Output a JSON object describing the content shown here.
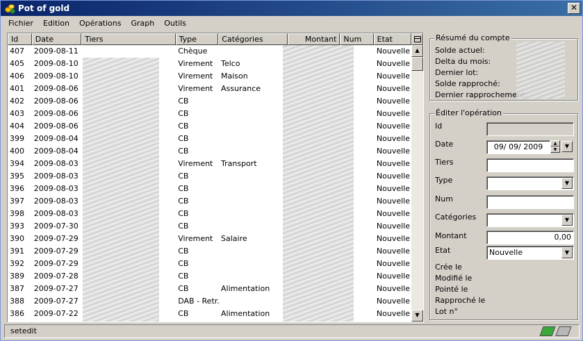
{
  "window": {
    "title": "Pot of gold",
    "close_label": "✕"
  },
  "menu": [
    "Fichier",
    "Edition",
    "Opérations",
    "Graph",
    "Outils"
  ],
  "table": {
    "columns": [
      "Id",
      "Date",
      "Tiers",
      "Type",
      "Catégories",
      "Montant",
      "Num",
      "Etat"
    ],
    "rows": [
      [
        "407",
        "2009-08-11",
        "",
        "Chèque",
        "",
        "",
        "",
        "Nouvelle"
      ],
      [
        "405",
        "2009-08-10",
        "",
        "Virement",
        "Telco",
        "",
        "",
        "Nouvelle"
      ],
      [
        "406",
        "2009-08-10",
        "",
        "Virement",
        "Maison",
        "",
        "",
        "Nouvelle"
      ],
      [
        "401",
        "2009-08-06",
        "",
        "Virement",
        "Assurance",
        "",
        "",
        "Nouvelle"
      ],
      [
        "402",
        "2009-08-06",
        "",
        "CB",
        "",
        "",
        "",
        "Nouvelle"
      ],
      [
        "403",
        "2009-08-06",
        "",
        "CB",
        "",
        "",
        "",
        "Nouvelle"
      ],
      [
        "404",
        "2009-08-06",
        "",
        "CB",
        "",
        "",
        "",
        "Nouvelle"
      ],
      [
        "399",
        "2009-08-04",
        "",
        "CB",
        "",
        "",
        "",
        "Nouvelle"
      ],
      [
        "400",
        "2009-08-04",
        "",
        "CB",
        "",
        "",
        "",
        "Nouvelle"
      ],
      [
        "394",
        "2009-08-03",
        "",
        "Virement",
        "Transport",
        "",
        "",
        "Nouvelle"
      ],
      [
        "395",
        "2009-08-03",
        "",
        "CB",
        "",
        "",
        "",
        "Nouvelle"
      ],
      [
        "396",
        "2009-08-03",
        "",
        "CB",
        "",
        "",
        "",
        "Nouvelle"
      ],
      [
        "397",
        "2009-08-03",
        "",
        "CB",
        "",
        "",
        "",
        "Nouvelle"
      ],
      [
        "398",
        "2009-08-03",
        "",
        "CB",
        "",
        "",
        "",
        "Nouvelle"
      ],
      [
        "393",
        "2009-07-30",
        "",
        "CB",
        "",
        "",
        "",
        "Nouvelle"
      ],
      [
        "390",
        "2009-07-29",
        "",
        "Virement",
        "Salaire",
        "",
        "",
        "Nouvelle"
      ],
      [
        "391",
        "2009-07-29",
        "",
        "CB",
        "",
        "",
        "",
        "Nouvelle"
      ],
      [
        "392",
        "2009-07-29",
        "",
        "CB",
        "",
        "",
        "",
        "Nouvelle"
      ],
      [
        "389",
        "2009-07-28",
        "",
        "CB",
        "",
        "",
        "",
        "Nouvelle"
      ],
      [
        "387",
        "2009-07-27",
        "",
        "CB",
        "Alimentation",
        "",
        "",
        "Nouvelle"
      ],
      [
        "388",
        "2009-07-27",
        "",
        "DAB - Retr...",
        "",
        "",
        "",
        "Nouvelle"
      ],
      [
        "386",
        "2009-07-22",
        "",
        "CB",
        "Alimentation",
        "",
        "",
        "Nouvelle"
      ]
    ]
  },
  "summary": {
    "title": "Résumé du compte",
    "labels": [
      "Solde actuel:",
      "Delta du mois:",
      "Dernier lot:",
      "Solde rapproché:",
      "Dernier rapprochement:"
    ]
  },
  "edit": {
    "title": "Éditer l'opération",
    "id_label": "Id",
    "date_label": "Date",
    "date_value": "09/ 09/  2009",
    "tiers_label": "Tiers",
    "type_label": "Type",
    "num_label": "Num",
    "cat_label": "Catégories",
    "montant_label": "Montant",
    "montant_value": "0,00",
    "etat_label": "Etat",
    "etat_value": "Nouvelle",
    "meta_labels": [
      "Crée le",
      "Modifié le",
      "Pointé le",
      "Rapproché le",
      "Lot n°"
    ]
  },
  "status": {
    "text": "setedit"
  },
  "icons": {
    "app": "pot-of-gold-icon",
    "column_config": "column-config-icon",
    "status_left": "money-icon",
    "status_right": "money-disabled-icon"
  },
  "colors": {
    "title_start": "#0a246a",
    "title_end": "#3a6ea5",
    "chrome": "#d4d0c8",
    "status_icon_green": "#3aa83a"
  }
}
